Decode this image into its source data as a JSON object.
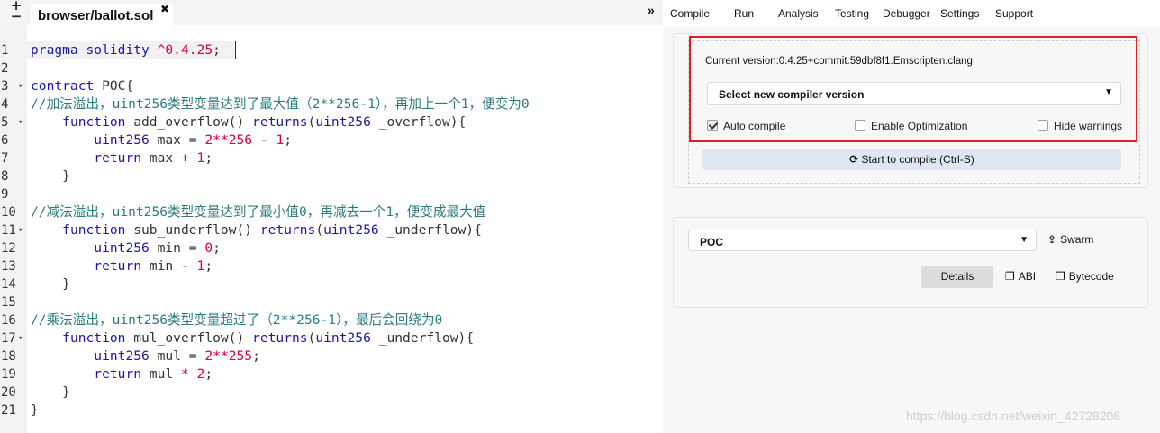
{
  "editor": {
    "plus_icon": "+",
    "minus_icon": "−",
    "tab_title": "browser/ballot.sol",
    "tab_close": "✖",
    "panel_toggle": "»",
    "line_numbers": [
      "1",
      "2",
      "3",
      "4",
      "5",
      "6",
      "7",
      "8",
      "9",
      "10",
      "11",
      "12",
      "13",
      "14",
      "15",
      "16",
      "17",
      "18",
      "19",
      "20",
      "21"
    ],
    "fold_marks": {
      "3": "▾",
      "5": "▾",
      "11": "▾",
      "17": "▾"
    },
    "code_lines": [
      "pragma solidity ^0.4.25;",
      "",
      "contract POC{",
      "//加法溢出，uint256类型变量达到了最大值（2**256-1），再加上一个1，便变为0",
      "    function add_overflow() returns(uint256 _overflow){",
      "        uint256 max = 2**256 - 1;",
      "        return max + 1;",
      "    }",
      "",
      "//减法溢出，uint256类型变量达到了最小值0，再减去一个1，便变成最大值",
      "    function sub_underflow() returns(uint256 _underflow){",
      "        uint256 min = 0;",
      "        return min - 1;",
      "    }",
      "",
      "//乘法溢出，uint256类型变量超过了（2**256-1），最后会回绕为0",
      "    function mul_overflow() returns(uint256 _underflow){",
      "        uint256 mul = 2**255;",
      "        return mul * 2;",
      "    }",
      "}"
    ]
  },
  "menu": {
    "items": [
      "Compile",
      "Run",
      "Analysis",
      "Testing",
      "Debugger",
      "Settings",
      "Support"
    ]
  },
  "compile": {
    "current_version": "Current version:0.4.25+commit.59dbf8f1.Emscripten.clang",
    "select_label": "Select new compiler version",
    "caret": "▼",
    "auto_compile_label": "Auto compile",
    "auto_compile_checked": true,
    "optimization_label": "Enable Optimization",
    "optimization_checked": false,
    "hide_warnings_label": "Hide warnings",
    "hide_warnings_checked": false,
    "compile_button_icon": "⟳",
    "compile_button_label": "Start to compile (Ctrl-S)"
  },
  "contract": {
    "selected": "POC",
    "caret": "▼",
    "swarm_icon": "⇪",
    "swarm_label": "Swarm",
    "details_label": "Details",
    "abi_icon": "❐",
    "abi_label": "ABI",
    "bytecode_icon": "❐",
    "bytecode_label": "Bytecode"
  },
  "watermark": "https://blog.csdn.net/weixin_42728208",
  "colors": {
    "keyword": "#1a1aa6",
    "number": "#e0003c",
    "comment": "#2f7c7c",
    "highlight_box": "#e3201f",
    "compile_button": "#e2e6f2"
  }
}
